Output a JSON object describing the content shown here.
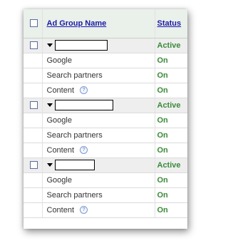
{
  "header": {
    "name_label": "Ad Group Name",
    "status_label": "Status"
  },
  "groups": [
    {
      "status": "Active",
      "networks": [
        {
          "label": "Google",
          "status": "On"
        },
        {
          "label": "Search partners",
          "status": "On"
        },
        {
          "label": "Content",
          "status": "On",
          "help_icon": "?"
        }
      ]
    },
    {
      "status": "Active",
      "networks": [
        {
          "label": "Google",
          "status": "On"
        },
        {
          "label": "Search partners",
          "status": "On"
        },
        {
          "label": "Content",
          "status": "On",
          "help_icon": "?"
        }
      ]
    },
    {
      "status": "Active",
      "networks": [
        {
          "label": "Google",
          "status": "On"
        },
        {
          "label": "Search partners",
          "status": "On"
        },
        {
          "label": "Content",
          "status": "On",
          "help_icon": "?"
        }
      ]
    }
  ],
  "colors": {
    "header_link": "#1a1aa6",
    "status_green": "#3a8a3a",
    "group_row_bg": "#eeeeee",
    "header_bg": "#eaf0ea"
  }
}
